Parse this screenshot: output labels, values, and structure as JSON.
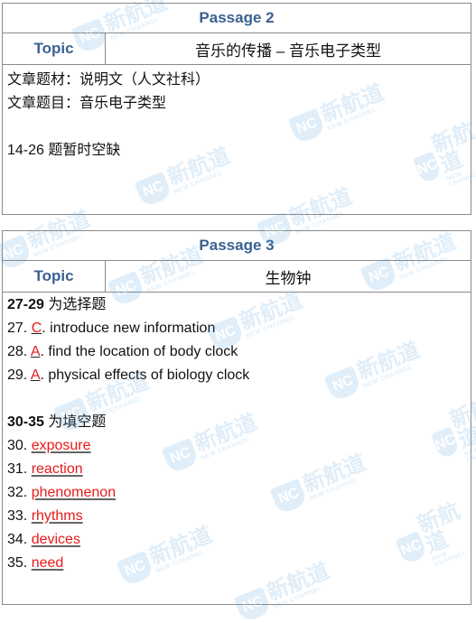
{
  "passage2": {
    "title": "Passage 2",
    "topic_label": "Topic",
    "topic_value": "音乐的传播 – 音乐电子类型",
    "lines": [
      "文章题材：说明文（人文社科）",
      "文章题目：音乐电子类型",
      "",
      "14-26 题暂时空缺"
    ]
  },
  "passage3": {
    "title": "Passage 3",
    "topic_label": "Topic",
    "topic_value": "生物钟",
    "mc_header_num": "27-29",
    "mc_header_text": " 为选择题",
    "mc_items": [
      {
        "num": "27. ",
        "letter": "C",
        "text": ". introduce new information"
      },
      {
        "num": "28. ",
        "letter": "A",
        "text": ". find the location of body clock"
      },
      {
        "num": "29. ",
        "letter": "A",
        "text": ". physical effects of biology clock"
      }
    ],
    "fill_header_num": "30-35",
    "fill_header_text": " 为填空题",
    "fill_items": [
      {
        "num": "30. ",
        "answer": "exposure"
      },
      {
        "num": "31. ",
        "answer": "reaction"
      },
      {
        "num": "32. ",
        "answer": "phenomenon"
      },
      {
        "num": "33. ",
        "answer": "rhythms"
      },
      {
        "num": "34. ",
        "answer": "devices"
      },
      {
        "num": "35. ",
        "answer": "need"
      }
    ]
  },
  "watermark": {
    "badge": "NC",
    "cn": "新航道",
    "en": "NEW CHANNEL"
  },
  "colors": {
    "heading": "#3b6192",
    "answer": "#e8191a",
    "border": "#8a8a8a"
  }
}
